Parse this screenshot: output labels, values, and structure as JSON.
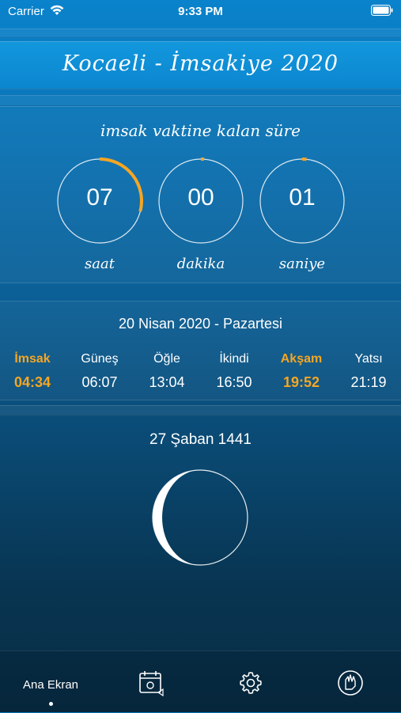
{
  "status_bar": {
    "carrier": "Carrier",
    "time": "9:33 PM",
    "wifi_icon": "wifi-icon",
    "battery_icon": "battery-icon"
  },
  "header": {
    "title": "Kocaeli - İmsakiye 2020"
  },
  "countdown": {
    "title": "imsak vaktine kalan süre",
    "accent_color": "#f5a623",
    "dials": [
      {
        "value": "07",
        "label": "saat",
        "progress": 0.29
      },
      {
        "value": "00",
        "label": "dakika",
        "progress": 0.0
      },
      {
        "value": "01",
        "label": "saniye",
        "progress": 0.017
      }
    ]
  },
  "prayer_times": {
    "date": "20 Nisan 2020 - Pazartesi",
    "highlight_color": "#f5a623",
    "items": [
      {
        "name": "İmsak",
        "time": "04:34",
        "highlight": true
      },
      {
        "name": "Güneş",
        "time": "06:07",
        "highlight": false
      },
      {
        "name": "Öğle",
        "time": "13:04",
        "highlight": false
      },
      {
        "name": "İkindi",
        "time": "16:50",
        "highlight": false
      },
      {
        "name": "Akşam",
        "time": "19:52",
        "highlight": true
      },
      {
        "name": "Yatsı",
        "time": "21:19",
        "highlight": false
      }
    ]
  },
  "hijri": {
    "date": "27 Şaban 1441",
    "moon_icon": "moon-phase-icon"
  },
  "tabbar": {
    "home_label": "Ana Ekran",
    "calendar_icon": "calendar-icon",
    "settings_icon": "gear-icon",
    "prayer_icon": "prayer-hand-icon"
  }
}
